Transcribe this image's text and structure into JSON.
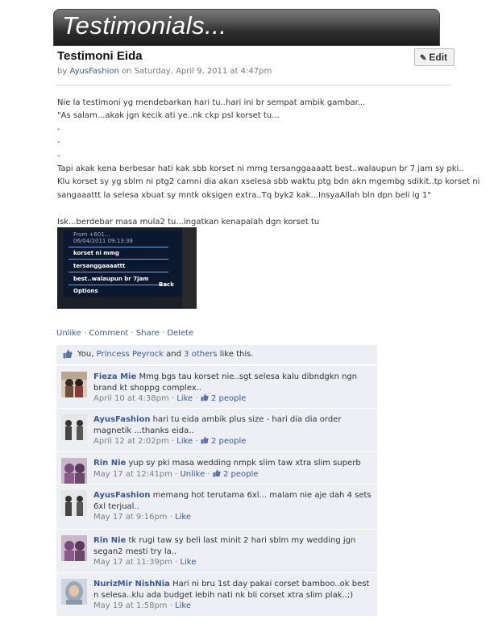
{
  "banner": {
    "title": "Testimonials..."
  },
  "post": {
    "title": "Testimoni Eida",
    "edit_label": "Edit",
    "byline_prefix": "by ",
    "author": "AyusFashion",
    "byline_suffix": " on Saturday, April 9, 2011 at 4:47pm"
  },
  "body": {
    "lines": [
      "Nie la testimoni yg mendebarkan hari tu..hari ini br sempat ambik gambar...",
      "\"As salam...akak jgn kecik ati ye..nk ckp psl korset tu...",
      "-",
      "-",
      "-",
      "Tapi akak kena berbesar hati kak sbb korset ni mmg tersanggaaaatt best..walaupun br 7 jam sy pki..",
      "Klu korset sy yg sblm ni ptg2 camni dia akan xselesa sbb waktu ptg bdn akn mgembg sdikit..tp korset ni",
      "sangaaattt la selesa xbuat sy mntk oksigen extra..Tq byk2 kak...InsyaAllah bln dpn beli lg 1\"",
      "",
      "Isk...berdebar masa mula2 tu...ingatkan kenapalah dgn korset tu"
    ]
  },
  "photo": {
    "rows": [
      "From +601...",
      "06/04/2011 09:13:38",
      "korset ni mmg",
      "tersanggaaaattt",
      "best..walaupun br 7jam",
      "Options",
      "Back"
    ]
  },
  "actions": {
    "unlike": "Unlike",
    "comment": "Comment",
    "share": "Share",
    "delete": "Delete",
    "sep": " · "
  },
  "likes": {
    "you": "You",
    "comma": ", ",
    "person": "Princess Peyrock",
    "and": " and ",
    "others": "3 others",
    "suffix": " like this."
  },
  "comments": [
    {
      "name": "Fieza Mie",
      "text": "Mmg bgs tau korset nie..sgt selesa kalu dibndgkn ngn brand kt shoppg complex..",
      "time": "April 10 at 4:38pm",
      "action": "Like",
      "likes": "2 people"
    },
    {
      "name": "AyusFashion",
      "text": "hari tu eida ambik plus size - hari dia dia order magnetik ...thanks eida..",
      "time": "April 12 at 2:02pm",
      "action": "Like",
      "likes": "2 people"
    },
    {
      "name": "Rin Nie",
      "text": "yup sy pki masa wedding nmpk slim taw xtra slim superb",
      "time": "May 17 at 12:41pm",
      "action": "Unlike",
      "likes": "2 people"
    },
    {
      "name": "AyusFashion",
      "text": "memang hot terutama 6xl... malam nie aje dah 4 sets 6xl terjual..",
      "time": "May 17 at 9:16pm",
      "action": "Like",
      "likes": ""
    },
    {
      "name": "Rin Nie",
      "text": "tk rugi taw sy beli last minit 2 hari sblm my wedding jgn segan2 mesti try la..",
      "time": "May 17 at 11:39pm",
      "action": "Like",
      "likes": ""
    },
    {
      "name": "NurizMir NishNia",
      "text": "Hari ni bru 1st day pakai corset bamboo..ok best n selesa..klu ada budget lebih nati nk bli corset xtra slim plak..;)",
      "time": "May 19 at 1:58pm",
      "action": "Like",
      "likes": ""
    }
  ],
  "colors": {
    "link": "#3b5998",
    "comment_bg": "#edeff4",
    "meta": "#808080"
  }
}
